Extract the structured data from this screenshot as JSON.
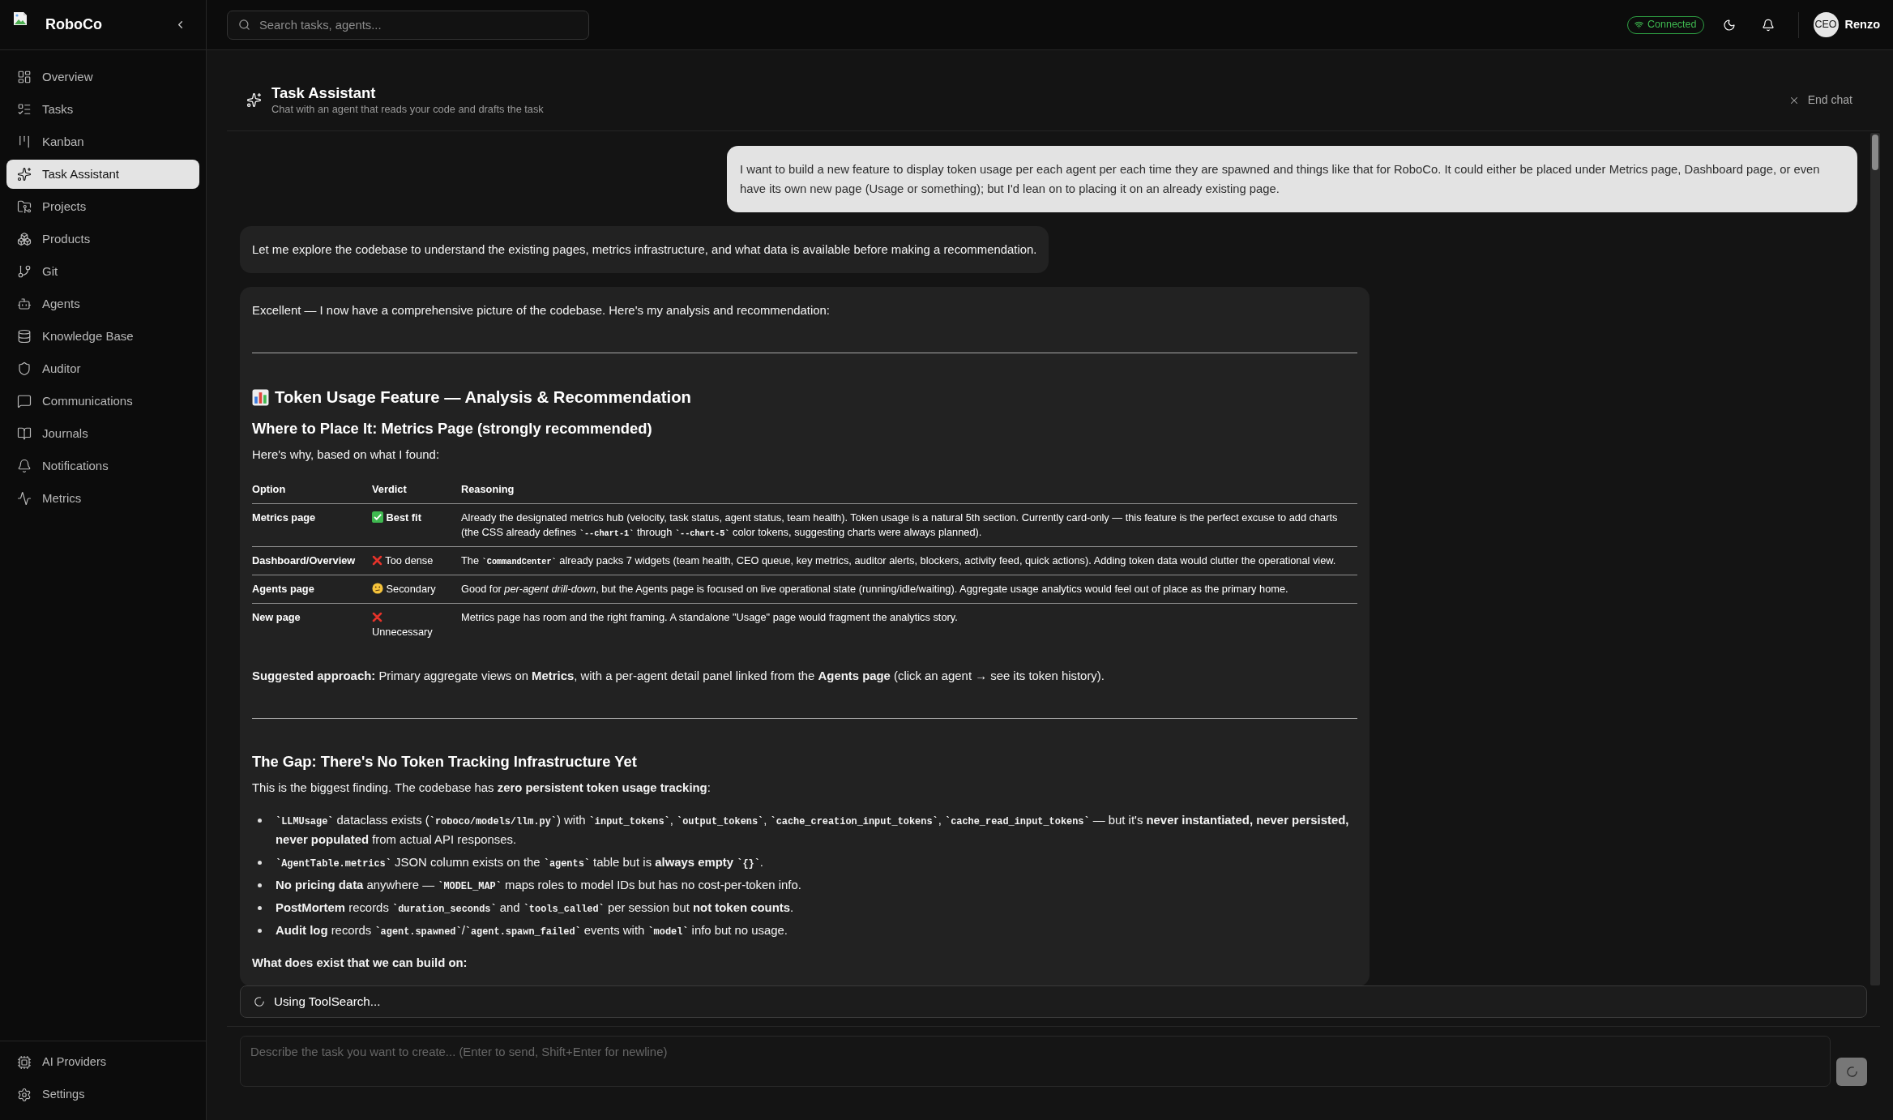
{
  "sidebar": {
    "brand": "RoboCo",
    "items": [
      {
        "label": "Overview",
        "selected": false
      },
      {
        "label": "Tasks",
        "selected": false
      },
      {
        "label": "Kanban",
        "selected": false
      },
      {
        "label": "Task Assistant",
        "selected": true
      },
      {
        "label": "Projects",
        "selected": false
      },
      {
        "label": "Products",
        "selected": false
      },
      {
        "label": "Git",
        "selected": false
      },
      {
        "label": "Agents",
        "selected": false
      },
      {
        "label": "Knowledge Base",
        "selected": false
      },
      {
        "label": "Auditor",
        "selected": false
      },
      {
        "label": "Communications",
        "selected": false
      },
      {
        "label": "Journals",
        "selected": false
      },
      {
        "label": "Notifications",
        "selected": false
      },
      {
        "label": "Metrics",
        "selected": false
      }
    ],
    "footer_items": [
      {
        "label": "AI Providers"
      },
      {
        "label": "Settings"
      }
    ]
  },
  "topbar": {
    "search": {
      "placeholder": "Search tasks, agents..."
    },
    "status": "Connected",
    "user": {
      "avatar": "CEO",
      "name": "Renzo"
    }
  },
  "chat": {
    "title": "Task Assistant",
    "subtitle": "Chat with an agent that reads your code and drafts the task",
    "end_label": "End chat",
    "messages": [
      {
        "kind": "user",
        "text": "I want to build a new feature to display token usage per each agent per each time they are spawned and things like that for RoboCo. It could either be placed under Metrics page, Dashboard page, or even have its own new page (Usage or something); but I'd lean on to placing it on an already existing page."
      },
      {
        "kind": "assistant",
        "blocks": [
          {
            "kind": "paragraph",
            "parts": [
              {
                "kind": "text",
                "text": "Let me explore the codebase to understand the existing pages, metrics infrastructure, and what data is available before making a recommendation."
              }
            ]
          }
        ]
      },
      {
        "kind": "assistant",
        "blocks": [
          {
            "kind": "paragraph",
            "parts": [
              {
                "kind": "text",
                "text": "Excellent — I now have a comprehensive picture of the codebase. Here's my analysis and recommendation:"
              }
            ]
          },
          {
            "kind": "rule"
          },
          {
            "kind": "title",
            "text": "Token Usage Feature — Analysis & Recommendation"
          },
          {
            "kind": "heading",
            "text": "Where to Place It: Metrics Page (strongly recommended)"
          },
          {
            "kind": "paragraph",
            "parts": [
              {
                "kind": "text",
                "text": "Here's why, based on what I found:"
              }
            ]
          },
          {
            "kind": "table",
            "columns": [
              "Option",
              "Verdict",
              "Reasoning"
            ],
            "rows": [
              {
                "option": "Metrics page",
                "verdict": {
                  "kind": "good",
                  "parts": [
                    {
                      "kind": "bold",
                      "text": "Best fit"
                    }
                  ]
                },
                "reasoning": [
                  {
                    "kind": "text",
                    "text": "Already the designated metrics hub (velocity, task status, agent status, team health). Token usage is a natural 5th section. Currently card-only — this feature is the perfect excuse to add charts (the CSS already defines "
                  },
                  {
                    "kind": "code",
                    "text": "`--chart-1`"
                  },
                  {
                    "kind": "text",
                    "text": " through "
                  },
                  {
                    "kind": "code",
                    "text": "`--chart-5`"
                  },
                  {
                    "kind": "text",
                    "text": " color tokens, suggesting charts were always planned)."
                  }
                ]
              },
              {
                "option": "Dashboard/Overview",
                "verdict": {
                  "kind": "bad",
                  "parts": [
                    {
                      "kind": "text",
                      "text": "Too dense"
                    }
                  ]
                },
                "reasoning": [
                  {
                    "kind": "text",
                    "text": "The "
                  },
                  {
                    "kind": "code",
                    "text": "`CommandCenter`"
                  },
                  {
                    "kind": "text",
                    "text": " already packs 7 widgets (team health, CEO queue, key metrics, auditor alerts, blockers, activity feed, quick actions). Adding token data would clutter the operational view."
                  }
                ]
              },
              {
                "option": "Agents page",
                "verdict": {
                  "kind": "unsure",
                  "parts": [
                    {
                      "kind": "text",
                      "text": "Secondary"
                    }
                  ]
                },
                "reasoning": [
                  {
                    "kind": "text",
                    "text": "Good for "
                  },
                  {
                    "kind": "italic",
                    "text": "per-agent drill-down"
                  },
                  {
                    "kind": "text",
                    "text": ", but the Agents page is focused on live operational state (running/idle/waiting). Aggregate usage analytics would feel out of place as the primary home."
                  }
                ]
              },
              {
                "option": "New page",
                "verdict": {
                  "kind": "bad",
                  "parts": [
                    {
                      "kind": "text",
                      "text": "Unnecessary"
                    }
                  ]
                },
                "reasoning": [
                  {
                    "kind": "text",
                    "text": "Metrics page has room and the right framing. A standalone \"Usage\" page would fragment the analytics story."
                  }
                ]
              }
            ]
          },
          {
            "kind": "paragraph",
            "parts": [
              {
                "kind": "bold",
                "text": "Suggested approach:"
              },
              {
                "kind": "text",
                "text": " Primary aggregate views on "
              },
              {
                "kind": "bold",
                "text": "Metrics"
              },
              {
                "kind": "text",
                "text": ", with a per-agent detail panel linked from the "
              },
              {
                "kind": "bold",
                "text": "Agents page"
              },
              {
                "kind": "text",
                "text": " (click an agent → see its token history)."
              }
            ]
          },
          {
            "kind": "rule"
          },
          {
            "kind": "heading",
            "text": "The Gap: There's No Token Tracking Infrastructure Yet"
          },
          {
            "kind": "paragraph",
            "parts": [
              {
                "kind": "text",
                "text": "This is the biggest finding. The codebase has "
              },
              {
                "kind": "bold",
                "text": "zero persistent token usage tracking"
              },
              {
                "kind": "text",
                "text": ":"
              }
            ]
          },
          {
            "kind": "bullets",
            "items": [
              [
                {
                  "kind": "code",
                  "text": "`LLMUsage`"
                },
                {
                  "kind": "text",
                  "text": " dataclass exists ("
                },
                {
                  "kind": "code",
                  "text": "`roboco/models/llm.py`"
                },
                {
                  "kind": "text",
                  "text": ") with "
                },
                {
                  "kind": "code",
                  "text": "`input_tokens`"
                },
                {
                  "kind": "text",
                  "text": ", "
                },
                {
                  "kind": "code",
                  "text": "`output_tokens`"
                },
                {
                  "kind": "text",
                  "text": ", "
                },
                {
                  "kind": "code",
                  "text": "`cache_creation_input_tokens`"
                },
                {
                  "kind": "text",
                  "text": ", "
                },
                {
                  "kind": "code",
                  "text": "`cache_read_input_tokens`"
                },
                {
                  "kind": "text",
                  "text": " — but it's "
                },
                {
                  "kind": "bold",
                  "text": "never instantiated, never persisted, never populated"
                },
                {
                  "kind": "text",
                  "text": " from actual API responses."
                }
              ],
              [
                {
                  "kind": "code",
                  "text": "`AgentTable.metrics`"
                },
                {
                  "kind": "text",
                  "text": " JSON column exists on the "
                },
                {
                  "kind": "code",
                  "text": "`agents`"
                },
                {
                  "kind": "text",
                  "text": " table but is "
                },
                {
                  "kind": "bold",
                  "text": "always empty "
                },
                {
                  "kind": "code",
                  "text": "`{}`"
                },
                {
                  "kind": "text",
                  "text": "."
                }
              ],
              [
                {
                  "kind": "bold",
                  "text": "No pricing data"
                },
                {
                  "kind": "text",
                  "text": " anywhere — "
                },
                {
                  "kind": "code",
                  "text": "`MODEL_MAP`"
                },
                {
                  "kind": "text",
                  "text": " maps roles to model IDs but has no cost-per-token info."
                }
              ],
              [
                {
                  "kind": "bold",
                  "text": "PostMortem"
                },
                {
                  "kind": "text",
                  "text": " records "
                },
                {
                  "kind": "code",
                  "text": "`duration_seconds`"
                },
                {
                  "kind": "text",
                  "text": " and "
                },
                {
                  "kind": "code",
                  "text": "`tools_called`"
                },
                {
                  "kind": "text",
                  "text": " per session but "
                },
                {
                  "kind": "bold",
                  "text": "not token counts"
                },
                {
                  "kind": "text",
                  "text": "."
                }
              ],
              [
                {
                  "kind": "bold",
                  "text": "Audit log"
                },
                {
                  "kind": "text",
                  "text": " records "
                },
                {
                  "kind": "code",
                  "text": "`agent.spawned`"
                },
                {
                  "kind": "text",
                  "text": "/"
                },
                {
                  "kind": "code",
                  "text": "`agent.spawn_failed`"
                },
                {
                  "kind": "text",
                  "text": " events with "
                },
                {
                  "kind": "code",
                  "text": "`model`"
                },
                {
                  "kind": "text",
                  "text": " info but no usage."
                }
              ]
            ]
          },
          {
            "kind": "paragraph",
            "parts": [
              {
                "kind": "bold",
                "text": "What does exist that we can build on:"
              }
            ]
          }
        ]
      }
    ],
    "activity": "Using ToolSearch...",
    "composer": {
      "placeholder": "Describe the task you want to create... (Enter to send, Shift+Enter for newline)"
    }
  }
}
